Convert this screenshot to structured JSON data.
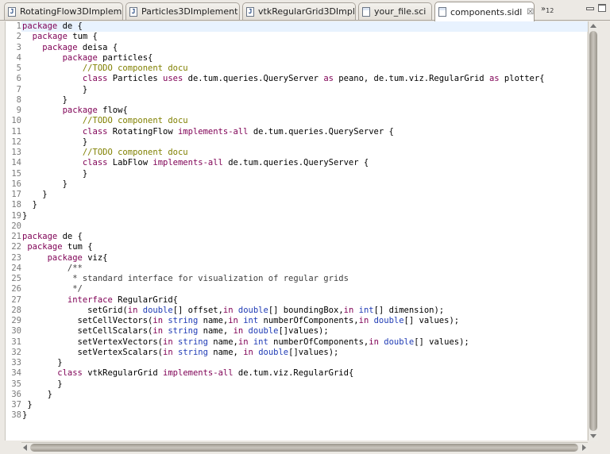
{
  "tabs": [
    {
      "label": "RotatingFlow3DImplem",
      "icon": "java-file-icon",
      "glyph": "J",
      "active": false
    },
    {
      "label": "Particles3DImplement",
      "icon": "java-file-icon",
      "glyph": "J",
      "active": false
    },
    {
      "label": "vtkRegularGrid3DImpl",
      "icon": "java-file-icon",
      "glyph": "J",
      "active": false
    },
    {
      "label": "your_file.sci",
      "icon": "sci-file-icon",
      "glyph": "",
      "active": false
    },
    {
      "label": "components.sidl",
      "icon": "sidl-file-icon",
      "glyph": "",
      "active": true,
      "close": "☒"
    }
  ],
  "overflow": {
    "chevron": "»",
    "count": "12"
  },
  "editor": {
    "lines": [
      [
        [
          "kw",
          "package"
        ],
        [
          "t",
          " de {"
        ]
      ],
      [
        [
          "t",
          "  "
        ],
        [
          "kw",
          "package"
        ],
        [
          "t",
          " tum {"
        ]
      ],
      [
        [
          "t",
          "    "
        ],
        [
          "kw",
          "package"
        ],
        [
          "t",
          " deisa {"
        ]
      ],
      [
        [
          "t",
          "        "
        ],
        [
          "kw",
          "package"
        ],
        [
          "t",
          " particles{"
        ]
      ],
      [
        [
          "t",
          "            "
        ],
        [
          "cm",
          "//TODO component docu"
        ]
      ],
      [
        [
          "t",
          "            "
        ],
        [
          "kw",
          "class"
        ],
        [
          "t",
          " Particles "
        ],
        [
          "kw",
          "uses"
        ],
        [
          "t",
          " de.tum.queries.QueryServer "
        ],
        [
          "kw",
          "as"
        ],
        [
          "t",
          " peano, de.tum.viz.RegularGrid "
        ],
        [
          "kw",
          "as"
        ],
        [
          "t",
          " plotter{"
        ]
      ],
      [
        [
          "t",
          "            }"
        ]
      ],
      [
        [
          "t",
          "        }"
        ]
      ],
      [
        [
          "t",
          "        "
        ],
        [
          "kw",
          "package"
        ],
        [
          "t",
          " flow{"
        ]
      ],
      [
        [
          "t",
          "            "
        ],
        [
          "cm",
          "//TODO component docu"
        ]
      ],
      [
        [
          "t",
          "            "
        ],
        [
          "kw",
          "class"
        ],
        [
          "t",
          " RotatingFlow "
        ],
        [
          "kw",
          "implements-all"
        ],
        [
          "t",
          " de.tum.queries.QueryServer {"
        ]
      ],
      [
        [
          "t",
          "            }"
        ]
      ],
      [
        [
          "t",
          "            "
        ],
        [
          "cm",
          "//TODO component docu"
        ]
      ],
      [
        [
          "t",
          "            "
        ],
        [
          "kw",
          "class"
        ],
        [
          "t",
          " LabFlow "
        ],
        [
          "kw",
          "implements-all"
        ],
        [
          "t",
          " de.tum.queries.QueryServer {"
        ]
      ],
      [
        [
          "t",
          "            }"
        ]
      ],
      [
        [
          "t",
          "        }"
        ]
      ],
      [
        [
          "t",
          "    }"
        ]
      ],
      [
        [
          "t",
          "  }"
        ]
      ],
      [
        [
          "t",
          "}"
        ]
      ],
      [
        [
          "t",
          ""
        ]
      ],
      [
        [
          "kw",
          "package"
        ],
        [
          "t",
          " de {"
        ]
      ],
      [
        [
          "t",
          " "
        ],
        [
          "kw",
          "package"
        ],
        [
          "t",
          " tum {"
        ]
      ],
      [
        [
          "t",
          "     "
        ],
        [
          "kw",
          "package"
        ],
        [
          "t",
          " viz{"
        ]
      ],
      [
        [
          "t",
          "         "
        ],
        [
          "dc",
          "/**"
        ]
      ],
      [
        [
          "t",
          "          "
        ],
        [
          "dc",
          "* standard interface for visualization of regular grids"
        ]
      ],
      [
        [
          "t",
          "          "
        ],
        [
          "dc",
          "*/"
        ]
      ],
      [
        [
          "t",
          "         "
        ],
        [
          "kw",
          "interface"
        ],
        [
          "t",
          " RegularGrid{"
        ]
      ],
      [
        [
          "t",
          "             setGrid("
        ],
        [
          "kw",
          "in"
        ],
        [
          "t",
          " "
        ],
        [
          "ty",
          "double"
        ],
        [
          "t",
          "[] offset,"
        ],
        [
          "kw",
          "in"
        ],
        [
          "t",
          " "
        ],
        [
          "ty",
          "double"
        ],
        [
          "t",
          "[] boundingBox,"
        ],
        [
          "kw",
          "in"
        ],
        [
          "t",
          " "
        ],
        [
          "ty",
          "int"
        ],
        [
          "t",
          "[] dimension);"
        ]
      ],
      [
        [
          "t",
          "           setCellVectors("
        ],
        [
          "kw",
          "in"
        ],
        [
          "t",
          " "
        ],
        [
          "ty",
          "string"
        ],
        [
          "t",
          " name,"
        ],
        [
          "kw",
          "in"
        ],
        [
          "t",
          " "
        ],
        [
          "ty",
          "int"
        ],
        [
          "t",
          " numberOfComponents,"
        ],
        [
          "kw",
          "in"
        ],
        [
          "t",
          " "
        ],
        [
          "ty",
          "double"
        ],
        [
          "t",
          "[] values);"
        ]
      ],
      [
        [
          "t",
          "           setCellScalars("
        ],
        [
          "kw",
          "in"
        ],
        [
          "t",
          " "
        ],
        [
          "ty",
          "string"
        ],
        [
          "t",
          " name, "
        ],
        [
          "kw",
          "in"
        ],
        [
          "t",
          " "
        ],
        [
          "ty",
          "double"
        ],
        [
          "t",
          "[]values);"
        ]
      ],
      [
        [
          "t",
          "           setVertexVectors("
        ],
        [
          "kw",
          "in"
        ],
        [
          "t",
          " "
        ],
        [
          "ty",
          "string"
        ],
        [
          "t",
          " name,"
        ],
        [
          "kw",
          "in"
        ],
        [
          "t",
          " "
        ],
        [
          "ty",
          "int"
        ],
        [
          "t",
          " numberOfComponents,"
        ],
        [
          "kw",
          "in"
        ],
        [
          "t",
          " "
        ],
        [
          "ty",
          "double"
        ],
        [
          "t",
          "[] values);"
        ]
      ],
      [
        [
          "t",
          "           setVertexScalars("
        ],
        [
          "kw",
          "in"
        ],
        [
          "t",
          " "
        ],
        [
          "ty",
          "string"
        ],
        [
          "t",
          " name, "
        ],
        [
          "kw",
          "in"
        ],
        [
          "t",
          " "
        ],
        [
          "ty",
          "double"
        ],
        [
          "t",
          "[]values);"
        ]
      ],
      [
        [
          "t",
          "       }"
        ]
      ],
      [
        [
          "t",
          "       "
        ],
        [
          "kw",
          "class"
        ],
        [
          "t",
          " vtkRegularGrid "
        ],
        [
          "kw",
          "implements-all"
        ],
        [
          "t",
          " de.tum.viz.RegularGrid{"
        ]
      ],
      [
        [
          "t",
          "       }"
        ]
      ],
      [
        [
          "t",
          "     }"
        ]
      ],
      [
        [
          "t",
          " }"
        ]
      ],
      [
        [
          "t",
          "}"
        ]
      ]
    ]
  }
}
